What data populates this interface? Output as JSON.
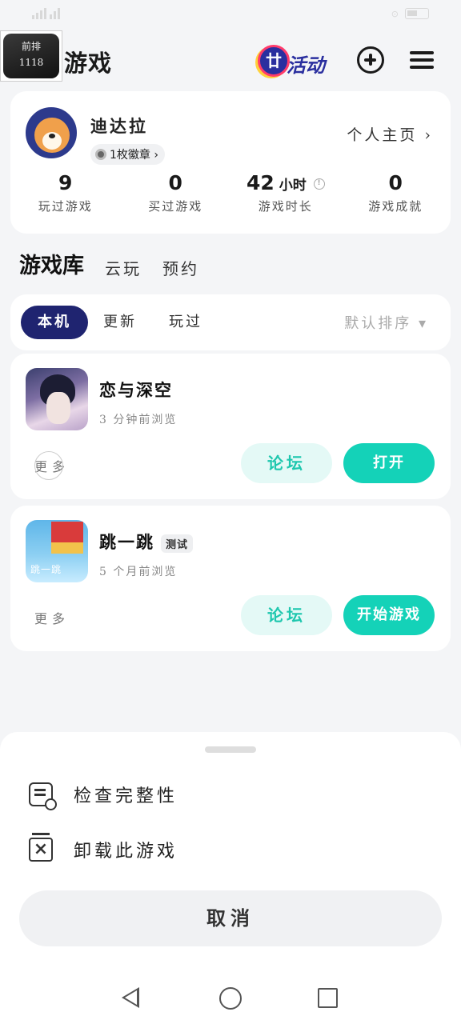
{
  "status_bar": {
    "carrier": "",
    "time": ""
  },
  "header": {
    "promo": {
      "line1": "前排",
      "line2": "1118"
    },
    "title": "游戏",
    "activity_label": "活动",
    "activity_glyph": "廿"
  },
  "profile": {
    "name": "迪达拉",
    "badge_text": "1枚徽章 ›",
    "home_link": "个人主页 ›",
    "stats": [
      {
        "value": "9",
        "unit": "",
        "label": "玩过游戏"
      },
      {
        "value": "0",
        "unit": "",
        "label": "买过游戏"
      },
      {
        "value": "42",
        "unit": "小时",
        "label": "游戏时长"
      },
      {
        "value": "0",
        "unit": "",
        "label": "游戏成就"
      }
    ]
  },
  "library_tabs": [
    "游戏库",
    "云玩",
    "预约"
  ],
  "filters": {
    "chips": [
      "本机",
      "更新",
      "玩过"
    ],
    "sort_label": "默认排序 ▾"
  },
  "games": [
    {
      "name": "恋与深空",
      "tag": "",
      "subtitle": "3 分钟前浏览",
      "more": "更多",
      "forum_label": "论坛",
      "primary_label": "打开"
    },
    {
      "name": "跳一跳",
      "tag": "测试",
      "subtitle": "5 个月前浏览",
      "more": "更多",
      "forum_label": "论坛",
      "primary_label": "开始游戏"
    }
  ],
  "sheet": {
    "items": [
      {
        "icon": "check-integrity-icon",
        "label": "检查完整性"
      },
      {
        "icon": "uninstall-icon",
        "label": "卸载此游戏"
      }
    ],
    "cancel_label": "取消"
  },
  "colors": {
    "accent": "#14d2b8",
    "active_chip": "#1f2470",
    "forum_bg": "#e4f9f6"
  }
}
